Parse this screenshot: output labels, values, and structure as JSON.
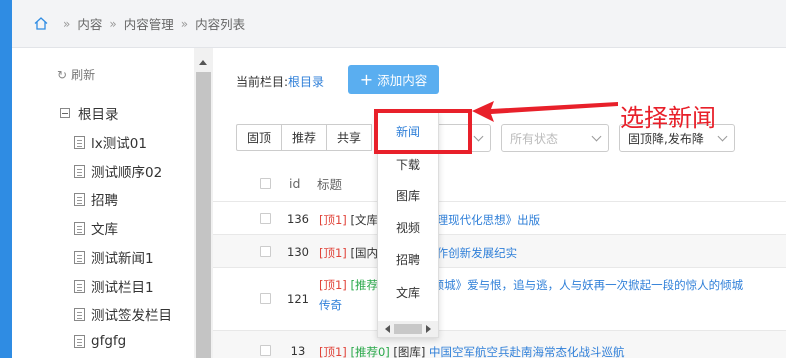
{
  "breadcrumb": {
    "items": [
      "内容",
      "内容管理",
      "内容列表"
    ]
  },
  "tree": {
    "refresh": "刷新",
    "root": "根目录",
    "nodes": [
      "lx测试01",
      "测试顺序02",
      "招聘",
      "文库",
      "测试新闻1",
      "测试栏目1",
      "测试签发栏目",
      "gfgfg"
    ]
  },
  "toolbar": {
    "current_label": "当前栏目:",
    "current_value": "根目录",
    "add_button": "添加内容"
  },
  "filters": {
    "buttons": [
      "固顶",
      "推荐",
      "共享"
    ],
    "status_placeholder": "所有状态",
    "sort_value": "固顶降,发布降"
  },
  "table": {
    "headers": {
      "id": "id",
      "title": "标题"
    },
    "rows": [
      {
        "id": "136",
        "tags": "[顶1]",
        "cat": "[文库]",
        "title": "国家治理现代化思想》出版"
      },
      {
        "id": "130",
        "tags": "[顶1]",
        "cat": "[国内]",
        "title": "民族工作创新发展纪实"
      },
      {
        "id": "121",
        "tags": "[顶1]",
        "rec": "[推荐",
        "title": "半妖倾城》爱与恨，追与逃，人与妖再一次掀起一段的惊人的倾城",
        "title2": "传奇"
      },
      {
        "id": "13",
        "tags": "[顶1]",
        "rec": "[推荐0]",
        "cat": "[图库]",
        "title": "中国空军航空兵赴南海常态化战斗巡航"
      }
    ]
  },
  "dropdown": {
    "items": [
      "新闻",
      "下载",
      "图库",
      "视频",
      "招聘",
      "文库"
    ]
  },
  "annotation": {
    "text": "选择新闻"
  },
  "colors": {
    "accent": "#2f8ce3",
    "button": "#5aaef0",
    "highlight": "#e8202a",
    "link": "#2f7fd8"
  }
}
